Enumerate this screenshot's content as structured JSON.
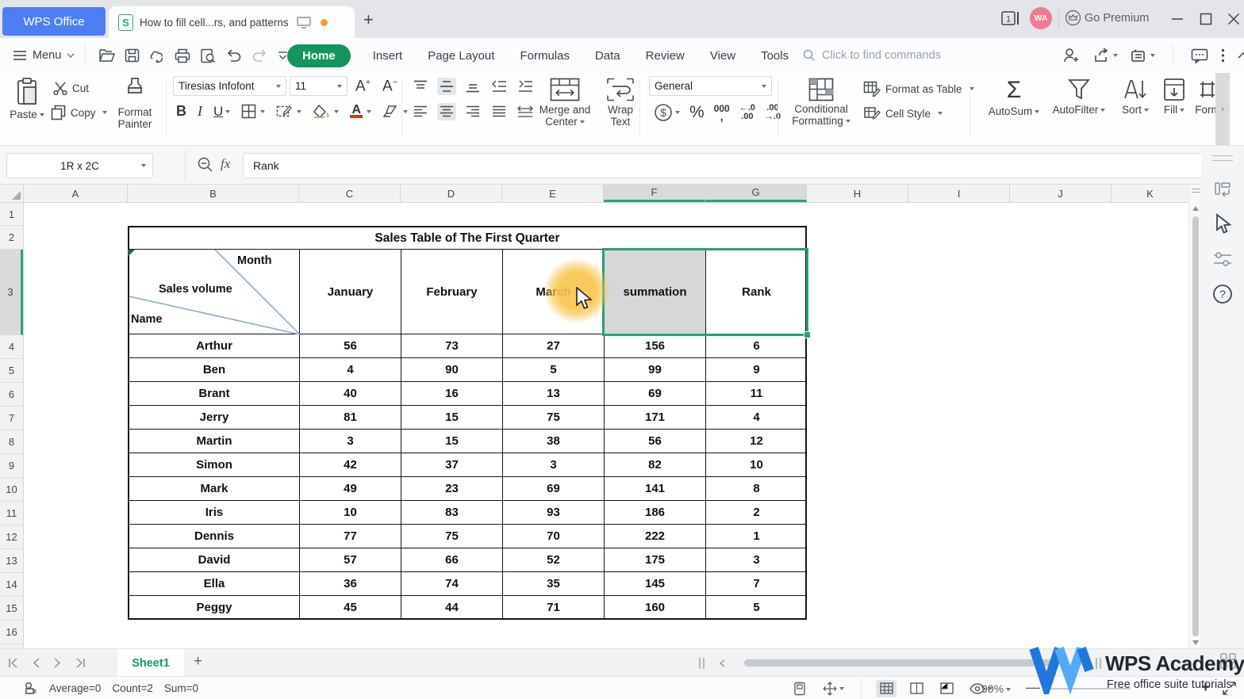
{
  "titlebar": {
    "app_button": "WPS Office",
    "doc_tab_title": "How to fill cell...rs, and patterns",
    "window_badge": "1",
    "avatar": "WA",
    "go_premium": "Go Premium"
  },
  "menubar": {
    "menu_label": "Menu",
    "tabs": [
      "Home",
      "Insert",
      "Page Layout",
      "Formulas",
      "Data",
      "Review",
      "View",
      "Tools"
    ],
    "search_placeholder": "Click to find commands"
  },
  "ribbon": {
    "paste": "Paste",
    "cut": "Cut",
    "copy": "Copy",
    "format_painter_1": "Format",
    "format_painter_2": "Painter",
    "font_name": "Tiresias Infofont",
    "font_size": "11",
    "merge_1": "Merge and",
    "merge_2": "Center",
    "wrap_1": "Wrap",
    "wrap_2": "Text",
    "number_format": "General",
    "cond_1": "Conditional",
    "cond_2": "Formatting",
    "format_as_table": "Format as Table",
    "cell_style": "Cell Style",
    "autosum": "AutoSum",
    "autofilter": "AutoFilter",
    "sort": "Sort",
    "fill": "Fill",
    "form": "Form"
  },
  "formula_bar": {
    "name_box": "1R x 2C",
    "fx": "fx",
    "value": "Rank"
  },
  "sheet": {
    "columns": [
      "A",
      "B",
      "C",
      "D",
      "E",
      "F",
      "G",
      "H",
      "I",
      "J",
      "K"
    ],
    "rows": [
      "1",
      "2",
      "3",
      "4",
      "5",
      "6",
      "7",
      "8",
      "9",
      "10",
      "11",
      "12",
      "13",
      "14",
      "15",
      "16"
    ]
  },
  "table": {
    "title": "Sales Table of The First Quarter",
    "corner": {
      "month": "Month",
      "sales_volume": "Sales volume",
      "name": "Name"
    },
    "headers": [
      "January",
      "February",
      "March",
      "summation",
      "Rank"
    ],
    "rows": [
      {
        "name": "Arthur",
        "values": [
          "56",
          "73",
          "27",
          "156",
          "6"
        ]
      },
      {
        "name": "Ben",
        "values": [
          "4",
          "90",
          "5",
          "99",
          "9"
        ]
      },
      {
        "name": "Brant",
        "values": [
          "40",
          "16",
          "13",
          "69",
          "11"
        ]
      },
      {
        "name": "Jerry",
        "values": [
          "81",
          "15",
          "75",
          "171",
          "4"
        ]
      },
      {
        "name": "Martin",
        "values": [
          "3",
          "15",
          "38",
          "56",
          "12"
        ]
      },
      {
        "name": "Simon",
        "values": [
          "42",
          "37",
          "3",
          "82",
          "10"
        ]
      },
      {
        "name": "Mark",
        "values": [
          "49",
          "23",
          "69",
          "141",
          "8"
        ]
      },
      {
        "name": "Iris",
        "values": [
          "10",
          "83",
          "93",
          "186",
          "2"
        ]
      },
      {
        "name": "Dennis",
        "values": [
          "77",
          "75",
          "70",
          "222",
          "1"
        ]
      },
      {
        "name": "David",
        "values": [
          "57",
          "66",
          "52",
          "175",
          "3"
        ]
      },
      {
        "name": "Ella",
        "values": [
          "36",
          "74",
          "35",
          "145",
          "7"
        ]
      },
      {
        "name": "Peggy",
        "values": [
          "45",
          "44",
          "71",
          "160",
          "5"
        ]
      }
    ]
  },
  "tabs_bar": {
    "sheet_name": "Sheet1"
  },
  "status_bar": {
    "average": "Average=0",
    "count": "Count=2",
    "sum": "Sum=0",
    "zoom": "90%"
  },
  "academy": {
    "brand": "WPS Academy",
    "tagline": "Free office suite tutorials"
  }
}
